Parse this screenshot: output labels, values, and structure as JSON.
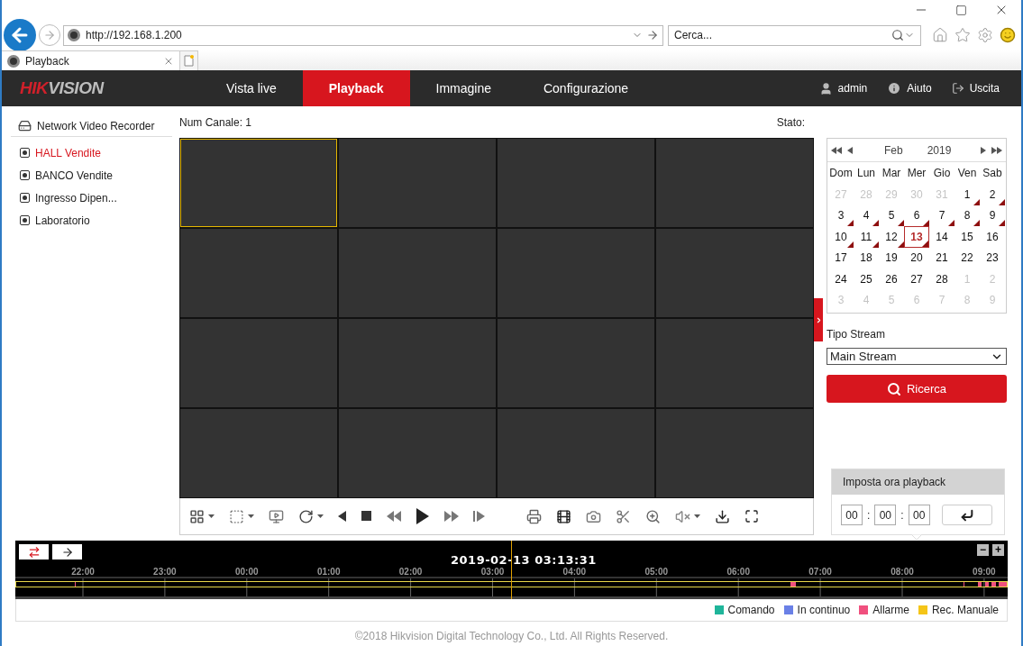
{
  "browser": {
    "url": "http://192.168.1.200",
    "search_placeholder": "Cerca...",
    "tab": {
      "title": "Playback"
    }
  },
  "nav": {
    "logo": "HIKVISION",
    "items": [
      {
        "label": "Vista live",
        "selected": false
      },
      {
        "label": "Playback",
        "selected": true
      },
      {
        "label": "Immagine",
        "selected": false
      },
      {
        "label": "Configurazione",
        "selected": false
      }
    ],
    "actions": [
      {
        "kind": "user",
        "label": "admin"
      },
      {
        "kind": "help",
        "label": "Aiuto"
      },
      {
        "kind": "logout",
        "label": "Uscita"
      }
    ]
  },
  "sidebar": {
    "device": "Network Video Recorder",
    "channels": [
      {
        "label": "HALL Vendite",
        "selected": true
      },
      {
        "label": "BANCO Vendite",
        "selected": false
      },
      {
        "label": "Ingresso Dipen...",
        "selected": false
      },
      {
        "label": "Laboratorio",
        "selected": false
      }
    ]
  },
  "player": {
    "channel": "Num Canale: 1",
    "status": "Stato:",
    "cells": [
      {
        "selected": true
      },
      {
        "selected": false
      },
      {
        "selected": false
      },
      {
        "selected": false
      },
      {
        "selected": false
      },
      {
        "selected": false
      },
      {
        "selected": false
      },
      {
        "selected": false
      },
      {
        "selected": false
      },
      {
        "selected": false
      },
      {
        "selected": false
      },
      {
        "selected": false
      },
      {
        "selected": false
      },
      {
        "selected": false
      },
      {
        "selected": false
      },
      {
        "selected": false
      }
    ]
  },
  "calendar": {
    "month": "Feb",
    "year": "2019",
    "weekdays": [
      "Dom",
      "Lun",
      "Mar",
      "Mer",
      "Gio",
      "Ven",
      "Sab"
    ],
    "days": [
      {
        "label": "27",
        "other_month": true,
        "recorded": false,
        "selected": false
      },
      {
        "label": "28",
        "other_month": true,
        "recorded": false,
        "selected": false
      },
      {
        "label": "29",
        "other_month": true,
        "recorded": false,
        "selected": false
      },
      {
        "label": "30",
        "other_month": true,
        "recorded": false,
        "selected": false
      },
      {
        "label": "31",
        "other_month": true,
        "recorded": false,
        "selected": false
      },
      {
        "label": "1",
        "other_month": false,
        "recorded": true,
        "selected": false
      },
      {
        "label": "2",
        "other_month": false,
        "recorded": true,
        "selected": false
      },
      {
        "label": "3",
        "other_month": false,
        "recorded": true,
        "selected": false
      },
      {
        "label": "4",
        "other_month": false,
        "recorded": true,
        "selected": false
      },
      {
        "label": "5",
        "other_month": false,
        "recorded": true,
        "selected": false
      },
      {
        "label": "6",
        "other_month": false,
        "recorded": true,
        "selected": false
      },
      {
        "label": "7",
        "other_month": false,
        "recorded": true,
        "selected": false
      },
      {
        "label": "8",
        "other_month": false,
        "recorded": true,
        "selected": false
      },
      {
        "label": "9",
        "other_month": false,
        "recorded": true,
        "selected": false
      },
      {
        "label": "10",
        "other_month": false,
        "recorded": true,
        "selected": false
      },
      {
        "label": "11",
        "other_month": false,
        "recorded": true,
        "selected": false
      },
      {
        "label": "12",
        "other_month": false,
        "recorded": true,
        "selected": false
      },
      {
        "label": "13",
        "other_month": false,
        "recorded": true,
        "selected": true
      },
      {
        "label": "14",
        "other_month": false,
        "recorded": false,
        "selected": false
      },
      {
        "label": "15",
        "other_month": false,
        "recorded": false,
        "selected": false
      },
      {
        "label": "16",
        "other_month": false,
        "recorded": false,
        "selected": false
      },
      {
        "label": "17",
        "other_month": false,
        "recorded": false,
        "selected": false
      },
      {
        "label": "18",
        "other_month": false,
        "recorded": false,
        "selected": false
      },
      {
        "label": "19",
        "other_month": false,
        "recorded": false,
        "selected": false
      },
      {
        "label": "20",
        "other_month": false,
        "recorded": false,
        "selected": false
      },
      {
        "label": "21",
        "other_month": false,
        "recorded": false,
        "selected": false
      },
      {
        "label": "22",
        "other_month": false,
        "recorded": false,
        "selected": false
      },
      {
        "label": "23",
        "other_month": false,
        "recorded": false,
        "selected": false
      },
      {
        "label": "24",
        "other_month": false,
        "recorded": false,
        "selected": false
      },
      {
        "label": "25",
        "other_month": false,
        "recorded": false,
        "selected": false
      },
      {
        "label": "26",
        "other_month": false,
        "recorded": false,
        "selected": false
      },
      {
        "label": "27",
        "other_month": false,
        "recorded": false,
        "selected": false
      },
      {
        "label": "28",
        "other_month": false,
        "recorded": false,
        "selected": false
      },
      {
        "label": "1",
        "other_month": true,
        "recorded": false,
        "selected": false
      },
      {
        "label": "2",
        "other_month": true,
        "recorded": false,
        "selected": false
      },
      {
        "label": "3",
        "other_month": true,
        "recorded": false,
        "selected": false
      },
      {
        "label": "4",
        "other_month": true,
        "recorded": false,
        "selected": false
      },
      {
        "label": "5",
        "other_month": true,
        "recorded": false,
        "selected": false
      },
      {
        "label": "6",
        "other_month": true,
        "recorded": false,
        "selected": false
      },
      {
        "label": "7",
        "other_month": true,
        "recorded": false,
        "selected": false
      },
      {
        "label": "8",
        "other_month": true,
        "recorded": false,
        "selected": false
      },
      {
        "label": "9",
        "other_month": true,
        "recorded": false,
        "selected": false
      }
    ]
  },
  "stream": {
    "label": "Tipo Stream",
    "value": "Main Stream"
  },
  "search_button": "Ricerca",
  "playback_time": {
    "title": "Imposta ora playback",
    "parts": [
      {
        "kind": "field",
        "text": "00"
      },
      {
        "kind": "separator",
        "text": ":"
      },
      {
        "kind": "field",
        "text": "00"
      },
      {
        "kind": "separator",
        "text": ":"
      },
      {
        "kind": "field",
        "text": "00"
      }
    ]
  },
  "timeline": {
    "current_time": "2019-02-13 03:13:31",
    "hours": [
      "22:00",
      "23:00",
      "00:00",
      "01:00",
      "02:00",
      "03:00",
      "04:00",
      "05:00",
      "06:00",
      "07:00",
      "08:00",
      "09:00"
    ],
    "zoom_out": "−",
    "zoom_in": "+"
  },
  "legend": [
    {
      "label": "Comando",
      "color": "#1fb59a"
    },
    {
      "label": "In continuo",
      "color": "#6a80e6"
    },
    {
      "label": "Allarme",
      "color": "#f0507e"
    },
    {
      "label": "Rec. Manuale",
      "color": "#f5c518"
    }
  ],
  "footer": "©2018 Hikvision Digital Technology Co., Ltd. All Rights Reserved."
}
